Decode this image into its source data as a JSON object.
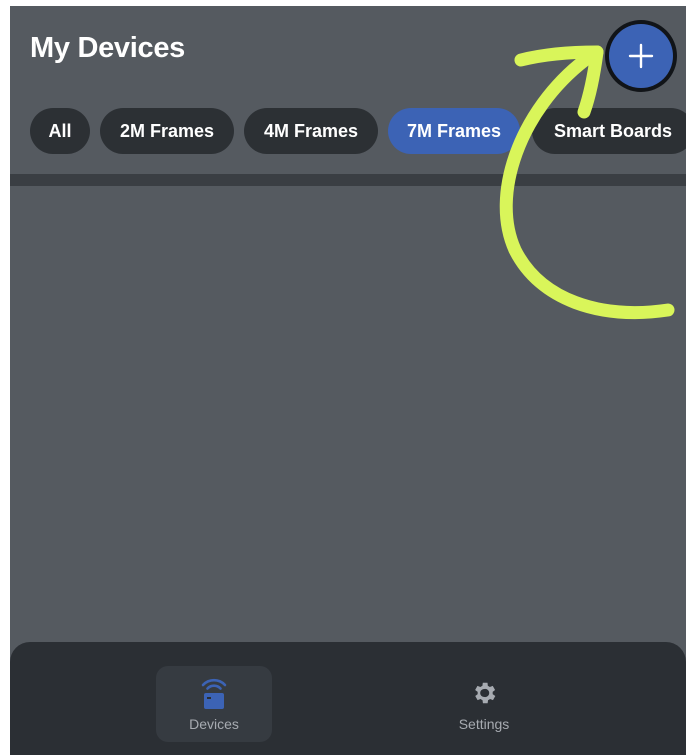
{
  "header": {
    "title": "My Devices",
    "add_button_icon": "plus-icon"
  },
  "filters": [
    {
      "label": "All",
      "active": false
    },
    {
      "label": "2M Frames",
      "active": false
    },
    {
      "label": "4M Frames",
      "active": false
    },
    {
      "label": "7M Frames",
      "active": true
    },
    {
      "label": "Smart Boards",
      "active": false
    }
  ],
  "bottom_nav": [
    {
      "label": "Devices",
      "icon": "device-wifi-icon",
      "active": true
    },
    {
      "label": "Settings",
      "icon": "gear-icon",
      "active": false
    }
  ],
  "annotation": {
    "icon": "curved-arrow-icon",
    "color": "#d9f55a"
  },
  "colors": {
    "accent": "#3c63b5",
    "background": "#555a60",
    "chip": "#2c3034",
    "nav": "#2b2f34"
  }
}
